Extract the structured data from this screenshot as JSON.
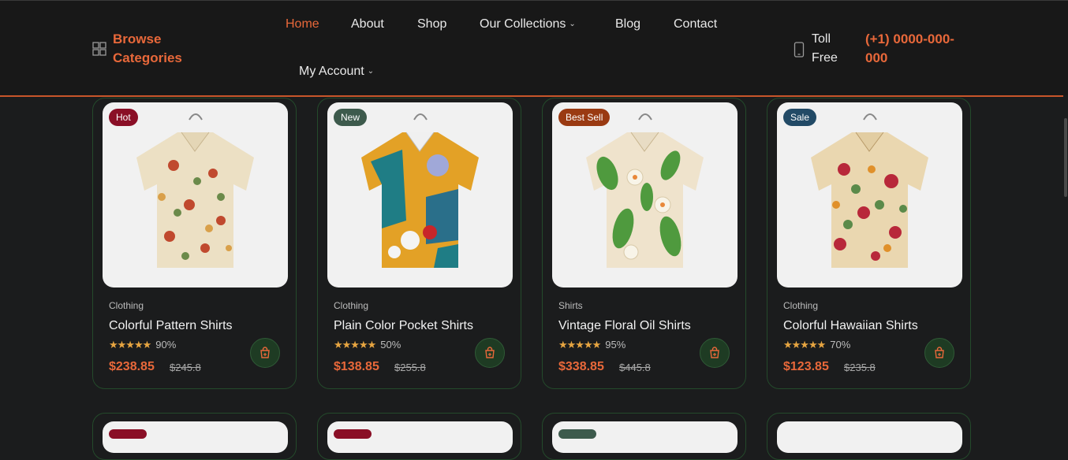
{
  "header": {
    "browse_label": "Browse Categories",
    "nav": [
      {
        "label": "Home",
        "active": true
      },
      {
        "label": "About"
      },
      {
        "label": "Shop"
      },
      {
        "label": "Our Collections",
        "dropdown": true
      },
      {
        "label": "Blog"
      },
      {
        "label": "Contact"
      },
      {
        "label": "My Account",
        "dropdown": true
      }
    ],
    "toll_label": "Toll Free",
    "phone": "(+1) 0000-000-000"
  },
  "colors": {
    "accent": "#e8683a",
    "background": "#1b1c1d",
    "card_border": "#244a2b",
    "badge_hot": "#8a0f26",
    "badge_new": "#3d5a4c",
    "badge_best": "#9a3a12",
    "badge_sale": "#224a66"
  },
  "products": [
    {
      "badge": "Hot",
      "category": "Clothing",
      "name": "Colorful Pattern Shirts",
      "stars": "★★★★★",
      "rating": "90%",
      "price": "$238.85",
      "old_price": "$245.8"
    },
    {
      "badge": "New",
      "category": "Clothing",
      "name": "Plain Color Pocket Shirts",
      "stars": "★★★★★",
      "rating": "50%",
      "price": "$138.85",
      "old_price": "$255.8"
    },
    {
      "badge": "Best Sell",
      "category": "Shirts",
      "name": "Vintage Floral Oil Shirts",
      "stars": "★★★★★",
      "rating": "95%",
      "price": "$338.85",
      "old_price": "$445.8"
    },
    {
      "badge": "Sale",
      "category": "Clothing",
      "name": "Colorful Hawaiian Shirts",
      "stars": "★★★★★",
      "rating": "70%",
      "price": "$123.85",
      "old_price": "$235.8"
    }
  ],
  "icons": {
    "browse": "grid-icon",
    "phone": "phone-icon",
    "cart": "cart-icon"
  }
}
